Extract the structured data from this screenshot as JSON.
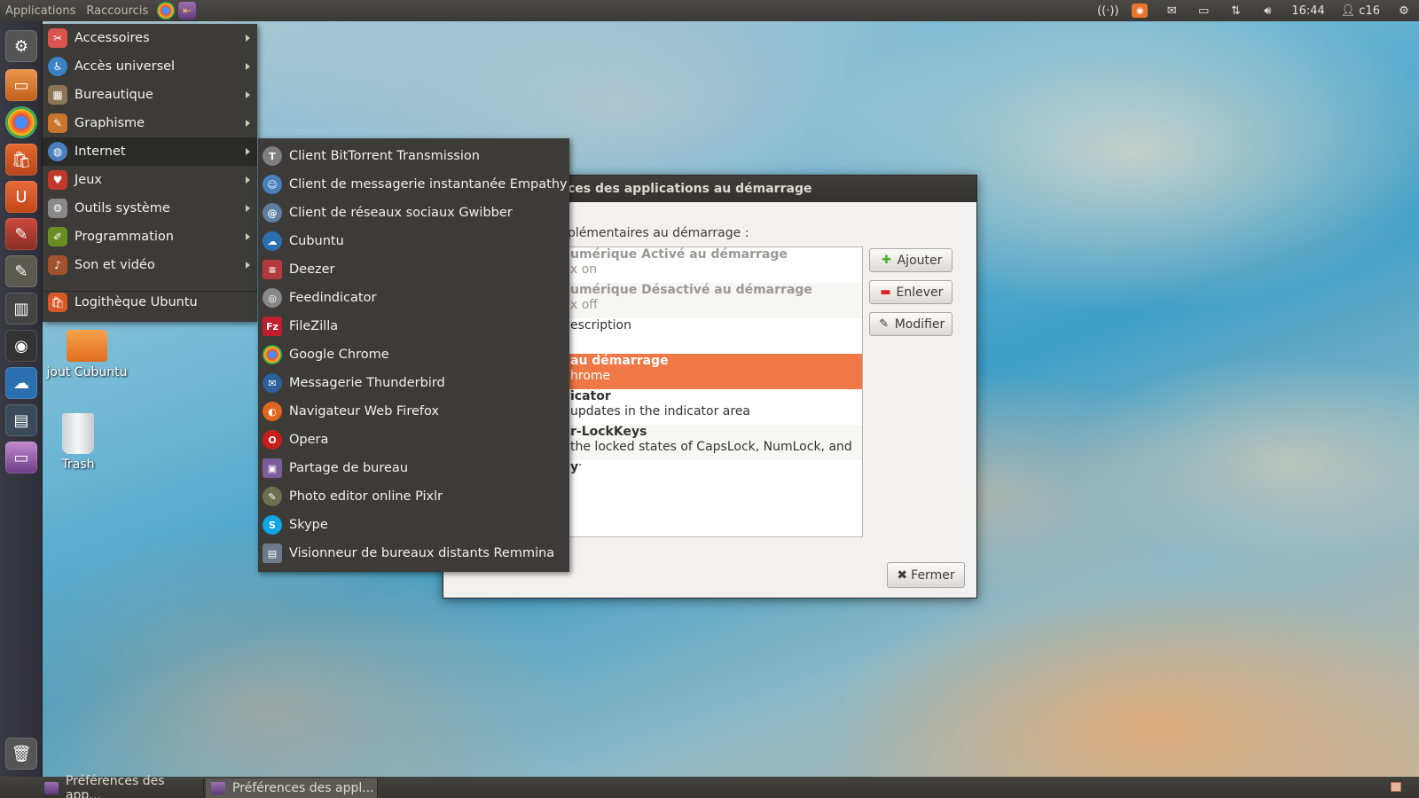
{
  "top_panel": {
    "applications_label": "Applications",
    "shortcuts_label": "Raccourcis",
    "clock": "16:44",
    "user": "c16"
  },
  "main_menu": {
    "items": [
      {
        "label": "Accessoires",
        "icon": "accessories-icon",
        "color": "#d9534f"
      },
      {
        "label": "Accès universel",
        "icon": "accessibility-icon",
        "color": "#3b82c4"
      },
      {
        "label": "Bureautique",
        "icon": "office-icon",
        "color": "#8b7355"
      },
      {
        "label": "Graphisme",
        "icon": "graphics-icon",
        "color": "#c9762c"
      },
      {
        "label": "Internet",
        "icon": "internet-icon",
        "color": "#4a7fbd"
      },
      {
        "label": "Jeux",
        "icon": "games-icon",
        "color": "#c0392b"
      },
      {
        "label": "Outils système",
        "icon": "system-tools-icon",
        "color": "#888888"
      },
      {
        "label": "Programmation",
        "icon": "programming-icon",
        "color": "#6b8e23"
      },
      {
        "label": "Son et vidéo",
        "icon": "sound-video-icon",
        "color": "#a0522d"
      }
    ],
    "software_center": "Logithèque Ubuntu"
  },
  "sub_menu": {
    "items": [
      {
        "label": "Client BitTorrent Transmission",
        "icon": "transmission-icon",
        "color": "#7f7f7f",
        "glyph": "T"
      },
      {
        "label": "Client de messagerie instantanée Empathy",
        "icon": "empathy-icon",
        "color": "#4a7fbd",
        "glyph": "☺"
      },
      {
        "label": "Client de réseaux sociaux Gwibber",
        "icon": "gwibber-icon",
        "color": "#5f7fa0",
        "glyph": "@"
      },
      {
        "label": "Cubuntu",
        "icon": "cubuntu-icon",
        "color": "#2a6fb0",
        "glyph": "☁"
      },
      {
        "label": "Deezer",
        "icon": "deezer-icon",
        "color": "#b33b3b",
        "glyph": "≡"
      },
      {
        "label": "Feedindicator",
        "icon": "feedindicator-icon",
        "color": "#888888",
        "glyph": "◎"
      },
      {
        "label": "FileZilla",
        "icon": "filezilla-icon",
        "color": "#bf1e2e",
        "glyph": "Fz"
      },
      {
        "label": "Google Chrome",
        "icon": "chrome-icon",
        "color": "#3a9b3a",
        "glyph": "●"
      },
      {
        "label": "Messagerie Thunderbird",
        "icon": "thunderbird-icon",
        "color": "#2d5f9a",
        "glyph": "✉"
      },
      {
        "label": "Navigateur Web Firefox",
        "icon": "firefox-icon",
        "color": "#e0661e",
        "glyph": "◐"
      },
      {
        "label": "Opera",
        "icon": "opera-icon",
        "color": "#cc1b1b",
        "glyph": "O"
      },
      {
        "label": "Partage de bureau",
        "icon": "desktop-sharing-icon",
        "color": "#7d5c9a",
        "glyph": "▣"
      },
      {
        "label": "Photo editor online Pixlr",
        "icon": "pixlr-icon",
        "color": "#6f6f4f",
        "glyph": "✎"
      },
      {
        "label": "Skype",
        "icon": "skype-icon",
        "color": "#12a5e3",
        "glyph": "S"
      },
      {
        "label": "Visionneur de bureaux distants Remmina",
        "icon": "remmina-icon",
        "color": "#6b7b8b",
        "glyph": "▤"
      }
    ]
  },
  "desktop": {
    "folder_label": "jout Cubuntu",
    "trash_label": "Trash"
  },
  "dialog": {
    "title": "ces des applications au démarrage",
    "list_label": "plémentaires au démarrage :",
    "rows": [
      {
        "t1": "umérique Activé au démarrage",
        "t2": "x on",
        "style": "dim"
      },
      {
        "t1": "umérique Désactivé au démarrage",
        "t2": "x off",
        "style": "dim alt"
      },
      {
        "t1": "",
        "t2": "escription",
        "style": ""
      },
      {
        "t1": "au démarrage",
        "t2": "hrome",
        "style": "sel"
      },
      {
        "t1": "icator",
        "t2": "updates in the indicator area",
        "style": ""
      },
      {
        "t1": "r-LockKeys",
        "t2": "the locked states of CapsLock, NumLock, and ...",
        "style": "alt"
      },
      {
        "t1": "y",
        "t2": "",
        "style": ""
      }
    ],
    "add_label": "Ajouter",
    "remove_label": "Enlever",
    "edit_label": "Modifier",
    "close_label": "Fermer"
  },
  "bottom_panel": {
    "task1": "Préférences des app...",
    "task2": "Préférences des appl..."
  },
  "colors": {
    "selection": "#f07746",
    "menu_bg": "#3c3b37"
  }
}
